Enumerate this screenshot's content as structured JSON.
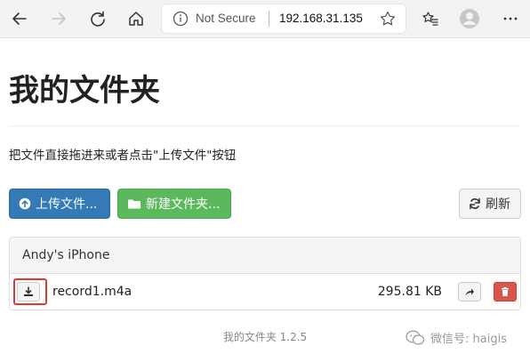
{
  "browser": {
    "security_label": "Not Secure",
    "url": "192.168.31.135",
    "icons": [
      "back-arrow-icon",
      "forward-arrow-icon",
      "refresh-icon",
      "home-icon",
      "info-icon",
      "star-icon",
      "favorites-icon",
      "profile-icon",
      "more-icon"
    ]
  },
  "page": {
    "title": "我的文件夹",
    "hint": "把文件直接拖进来或者点击\"上传文件\"按钮"
  },
  "actions": {
    "upload_label": "上传文件...",
    "newfolder_label": "新建文件夹...",
    "refresh_label": "刷新"
  },
  "panel": {
    "title": "Andy's iPhone",
    "files": [
      {
        "name": "record1.m4a",
        "size": "295.81 KB"
      }
    ]
  },
  "footer": {
    "text": "我的文件夹 1.2.5"
  },
  "watermark": {
    "text": "微信号: haigis"
  },
  "colors": {
    "primary": "#337ab7",
    "success": "#5cb85c",
    "danger": "#d9534f",
    "highlight": "#e03b24"
  }
}
